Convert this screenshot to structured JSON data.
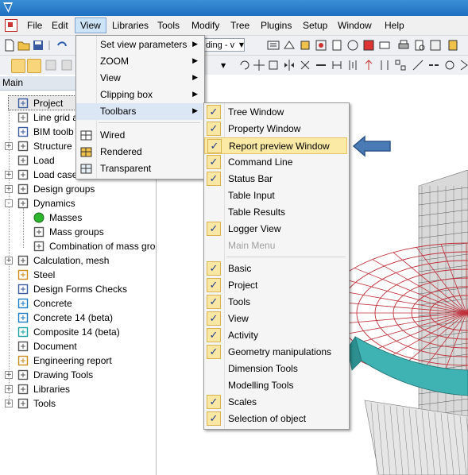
{
  "menubar": {
    "items": [
      "File",
      "Edit",
      "View",
      "Libraries",
      "Tools",
      "Modify",
      "Tree",
      "Plugins",
      "Setup",
      "Window",
      "Help"
    ]
  },
  "toolbar": {
    "combo_value": "ding - v"
  },
  "panel": {
    "title": "Main"
  },
  "tree": [
    {
      "label": "Project",
      "icon": "project-icon"
    },
    {
      "label": "Line grid a",
      "icon": "line-grid-icon"
    },
    {
      "label": "BIM toolb",
      "icon": "bim-toolbox-icon"
    },
    {
      "label": "Structure",
      "icon": "structure-icon"
    },
    {
      "label": "Load",
      "icon": "load-icon"
    },
    {
      "label": "Load case",
      "icon": "load-case-icon"
    },
    {
      "label": "Design groups",
      "icon": "design-groups-icon"
    },
    {
      "label": "Dynamics",
      "icon": "dynamics-icon"
    },
    {
      "label": "Masses",
      "icon": "masses-icon"
    },
    {
      "label": "Mass groups",
      "icon": "mass-groups-icon"
    },
    {
      "label": "Combination of mass gro",
      "icon": "mass-combination-icon"
    },
    {
      "label": "Calculation, mesh",
      "icon": "calculation-icon"
    },
    {
      "label": "Steel",
      "icon": "steel-icon"
    },
    {
      "label": "Design Forms Checks",
      "icon": "design-forms-icon"
    },
    {
      "label": "Concrete",
      "icon": "concrete-icon"
    },
    {
      "label": "Concrete 14 (beta)",
      "icon": "concrete14-icon"
    },
    {
      "label": "Composite 14 (beta)",
      "icon": "composite-icon"
    },
    {
      "label": "Document",
      "icon": "document-icon"
    },
    {
      "label": "Engineering report",
      "icon": "engineering-report-icon"
    },
    {
      "label": "Drawing Tools",
      "icon": "drawing-tools-icon"
    },
    {
      "label": "Libraries",
      "icon": "libraries-icon"
    },
    {
      "label": "Tools",
      "icon": "tools-icon"
    }
  ],
  "view_menu": {
    "items": [
      {
        "label": "Set view parameters",
        "submenu": true
      },
      {
        "label": "ZOOM",
        "submenu": true
      },
      {
        "label": "View",
        "submenu": true
      },
      {
        "label": "Clipping box",
        "submenu": true
      },
      {
        "label": "Toolbars",
        "submenu": true
      },
      {
        "label": "Wired",
        "submenu": false
      },
      {
        "label": "Rendered",
        "submenu": false
      },
      {
        "label": "Transparent",
        "submenu": false
      }
    ]
  },
  "toolbars_menu": {
    "items": [
      {
        "label": "Tree Window",
        "checked": true
      },
      {
        "label": "Property Window",
        "checked": true
      },
      {
        "label": "Report preview Window",
        "checked": true
      },
      {
        "label": "Command Line",
        "checked": true
      },
      {
        "label": "Status Bar",
        "checked": true
      },
      {
        "label": "Table Input",
        "checked": false
      },
      {
        "label": "Table Results",
        "checked": false
      },
      {
        "label": "Logger View",
        "checked": true
      },
      {
        "label": "Main Menu",
        "checked": false,
        "disabled": true
      },
      {
        "label": "Basic",
        "checked": true
      },
      {
        "label": "Project",
        "checked": true
      },
      {
        "label": "Tools",
        "checked": true
      },
      {
        "label": "View",
        "checked": true
      },
      {
        "label": "Activity",
        "checked": true
      },
      {
        "label": "Geometry manipulations",
        "checked": true
      },
      {
        "label": "Dimension Tools",
        "checked": false
      },
      {
        "label": "Modelling Tools",
        "checked": false
      },
      {
        "label": "Scales",
        "checked": true
      },
      {
        "label": "Selection of object",
        "checked": true
      }
    ]
  },
  "colors": {
    "accent": "#4a7ab5",
    "highlight": "#fbe9a6",
    "menu_active": "#cde4f7",
    "wireframe": "#c0303a",
    "model_fill": "#3fb3b3"
  },
  "callout": {
    "icon": "pointer-arrow-icon"
  }
}
